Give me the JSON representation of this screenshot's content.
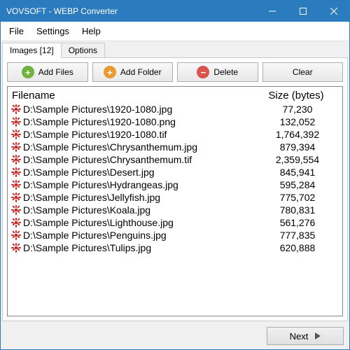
{
  "window": {
    "title": "VOVSOFT - WEBP Converter"
  },
  "menu": {
    "file": "File",
    "settings": "Settings",
    "help": "Help"
  },
  "tabs": {
    "images": "Images [12]",
    "options": "Options"
  },
  "toolbar": {
    "add_files": "Add Files",
    "add_folder": "Add Folder",
    "delete": "Delete",
    "clear": "Clear"
  },
  "headers": {
    "filename": "Filename",
    "size": "Size (bytes)"
  },
  "rows": [
    {
      "filename": "D:\\Sample Pictures\\1920-1080.jpg",
      "size": "77,230"
    },
    {
      "filename": "D:\\Sample Pictures\\1920-1080.png",
      "size": "132,052"
    },
    {
      "filename": "D:\\Sample Pictures\\1920-1080.tif",
      "size": "1,764,392"
    },
    {
      "filename": "D:\\Sample Pictures\\Chrysanthemum.jpg",
      "size": "879,394"
    },
    {
      "filename": "D:\\Sample Pictures\\Chrysanthemum.tif",
      "size": "2,359,554"
    },
    {
      "filename": "D:\\Sample Pictures\\Desert.jpg",
      "size": "845,941"
    },
    {
      "filename": "D:\\Sample Pictures\\Hydrangeas.jpg",
      "size": "595,284"
    },
    {
      "filename": "D:\\Sample Pictures\\Jellyfish.jpg",
      "size": "775,702"
    },
    {
      "filename": "D:\\Sample Pictures\\Koala.jpg",
      "size": "780,831"
    },
    {
      "filename": "D:\\Sample Pictures\\Lighthouse.jpg",
      "size": "561,276"
    },
    {
      "filename": "D:\\Sample Pictures\\Penguins.jpg",
      "size": "777,835"
    },
    {
      "filename": "D:\\Sample Pictures\\Tulips.jpg",
      "size": "620,888"
    }
  ],
  "footer": {
    "next": "Next"
  }
}
